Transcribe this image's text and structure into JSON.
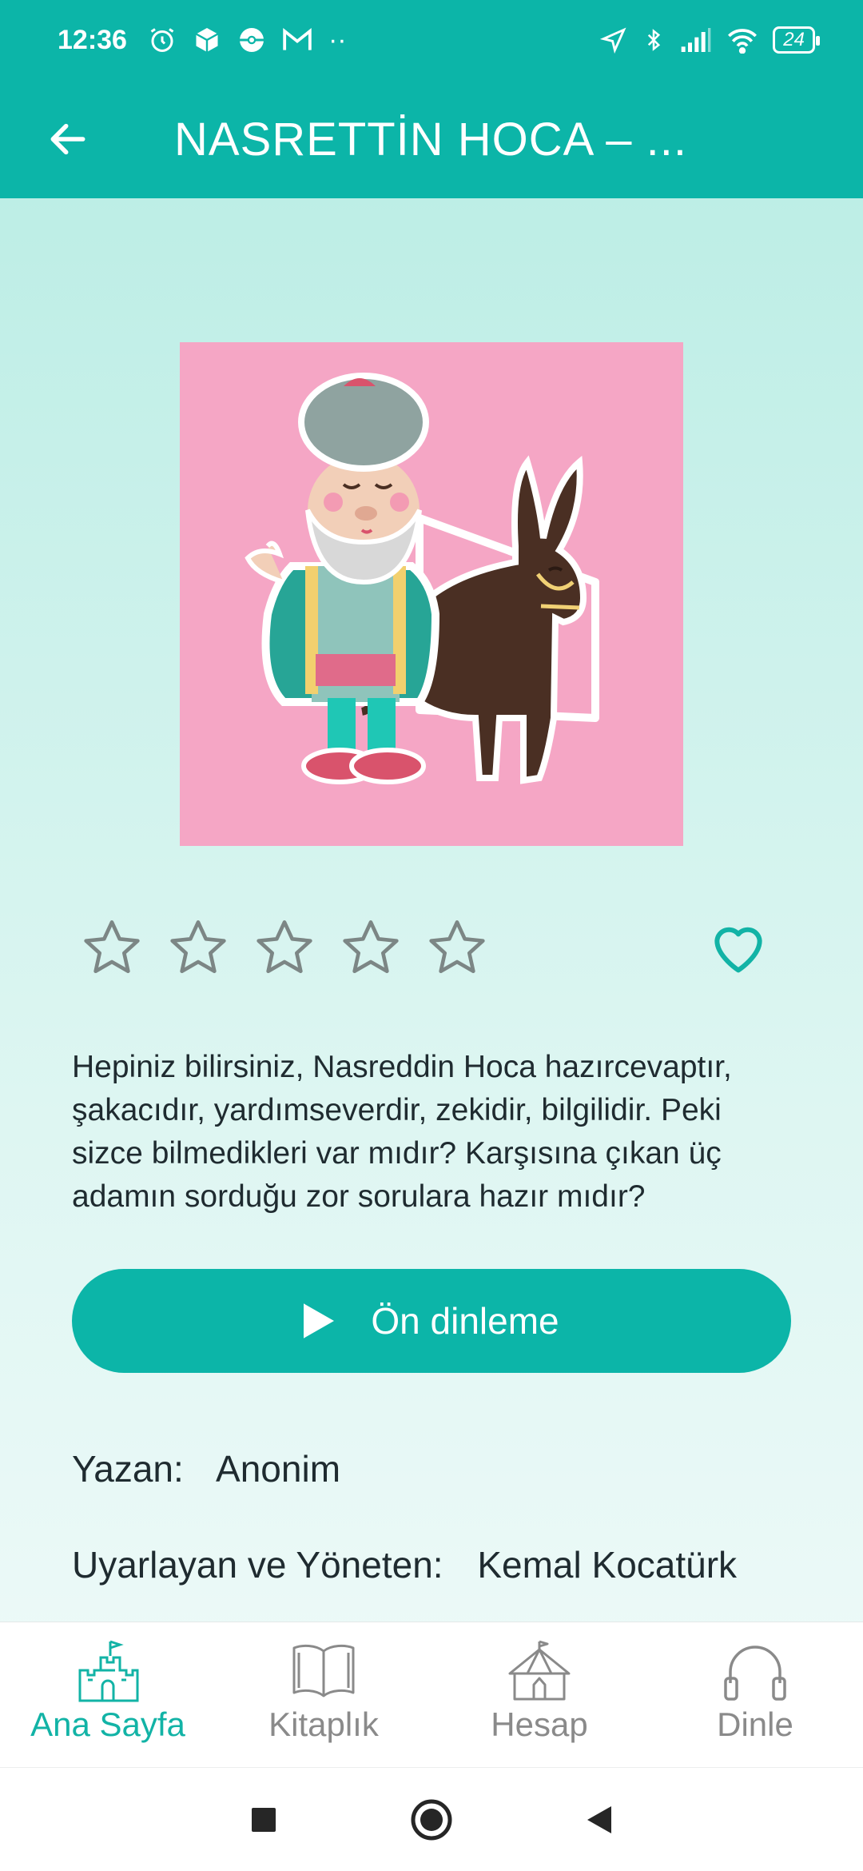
{
  "status_bar": {
    "time": "12:36",
    "battery": "24",
    "more_indicator": "··"
  },
  "app_bar": {
    "title": "NASRETTİN HOCA – ..."
  },
  "cover": {
    "icon": "nasreddin-hoca-donkey-illustration",
    "background": "#f5a6c5"
  },
  "rating": {
    "stars": 5,
    "value": 0
  },
  "favorite": {
    "active": false
  },
  "description": "Hepiniz bilirsiniz, Nasreddin Hoca hazırcevaptır, şakacıdır, yardımseverdir, zekidir, bilgilidir. Peki sizce bilmedikleri var mıdır? Karşısına çıkan üç adamın sorduğu zor sorulara hazır mıdır?",
  "preview_button": {
    "label": "Ön dinleme"
  },
  "meta": {
    "author_label": "Yazan:",
    "author_value": "Anonim",
    "adapter_label": "Uyarlayan ve Yöneten:",
    "adapter_value": "Kemal Kocatürk"
  },
  "bottom_nav": {
    "items": [
      {
        "label": "Ana Sayfa",
        "icon": "castle-icon",
        "active": true
      },
      {
        "label": "Kitaplık",
        "icon": "book-icon",
        "active": false
      },
      {
        "label": "Hesap",
        "icon": "tent-icon",
        "active": false
      },
      {
        "label": "Dinle",
        "icon": "headphones-icon",
        "active": false
      }
    ]
  },
  "colors": {
    "primary": "#0cb5a8",
    "active_nav": "#12b3a6",
    "inactive_nav": "#8a8a8a",
    "star_outline": "#7c8685"
  }
}
